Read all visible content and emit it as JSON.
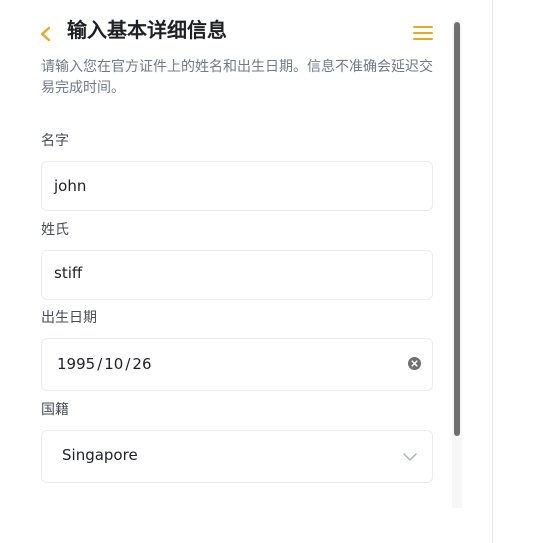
{
  "header": {
    "title": "输入基本详细信息",
    "back_icon": "chevron-left-icon",
    "menu_icon": "hamburger-menu-icon",
    "accent_color": "#F0A51A"
  },
  "subtitle": "请输入您在官方证件上的姓名和出生日期。信息不准确会延迟交易完成时间。",
  "form": {
    "first_name": {
      "label": "名字",
      "value": "john"
    },
    "last_name": {
      "label": "姓氏",
      "value": "stiff"
    },
    "birth_date": {
      "label": "出生日期",
      "year": "1995",
      "month": "10",
      "day": "26",
      "separator": "/",
      "clear_icon": "clear-circle-icon"
    },
    "nationality": {
      "label": "国籍",
      "value": "Singapore",
      "dropdown_icon": "chevron-down-icon"
    }
  }
}
